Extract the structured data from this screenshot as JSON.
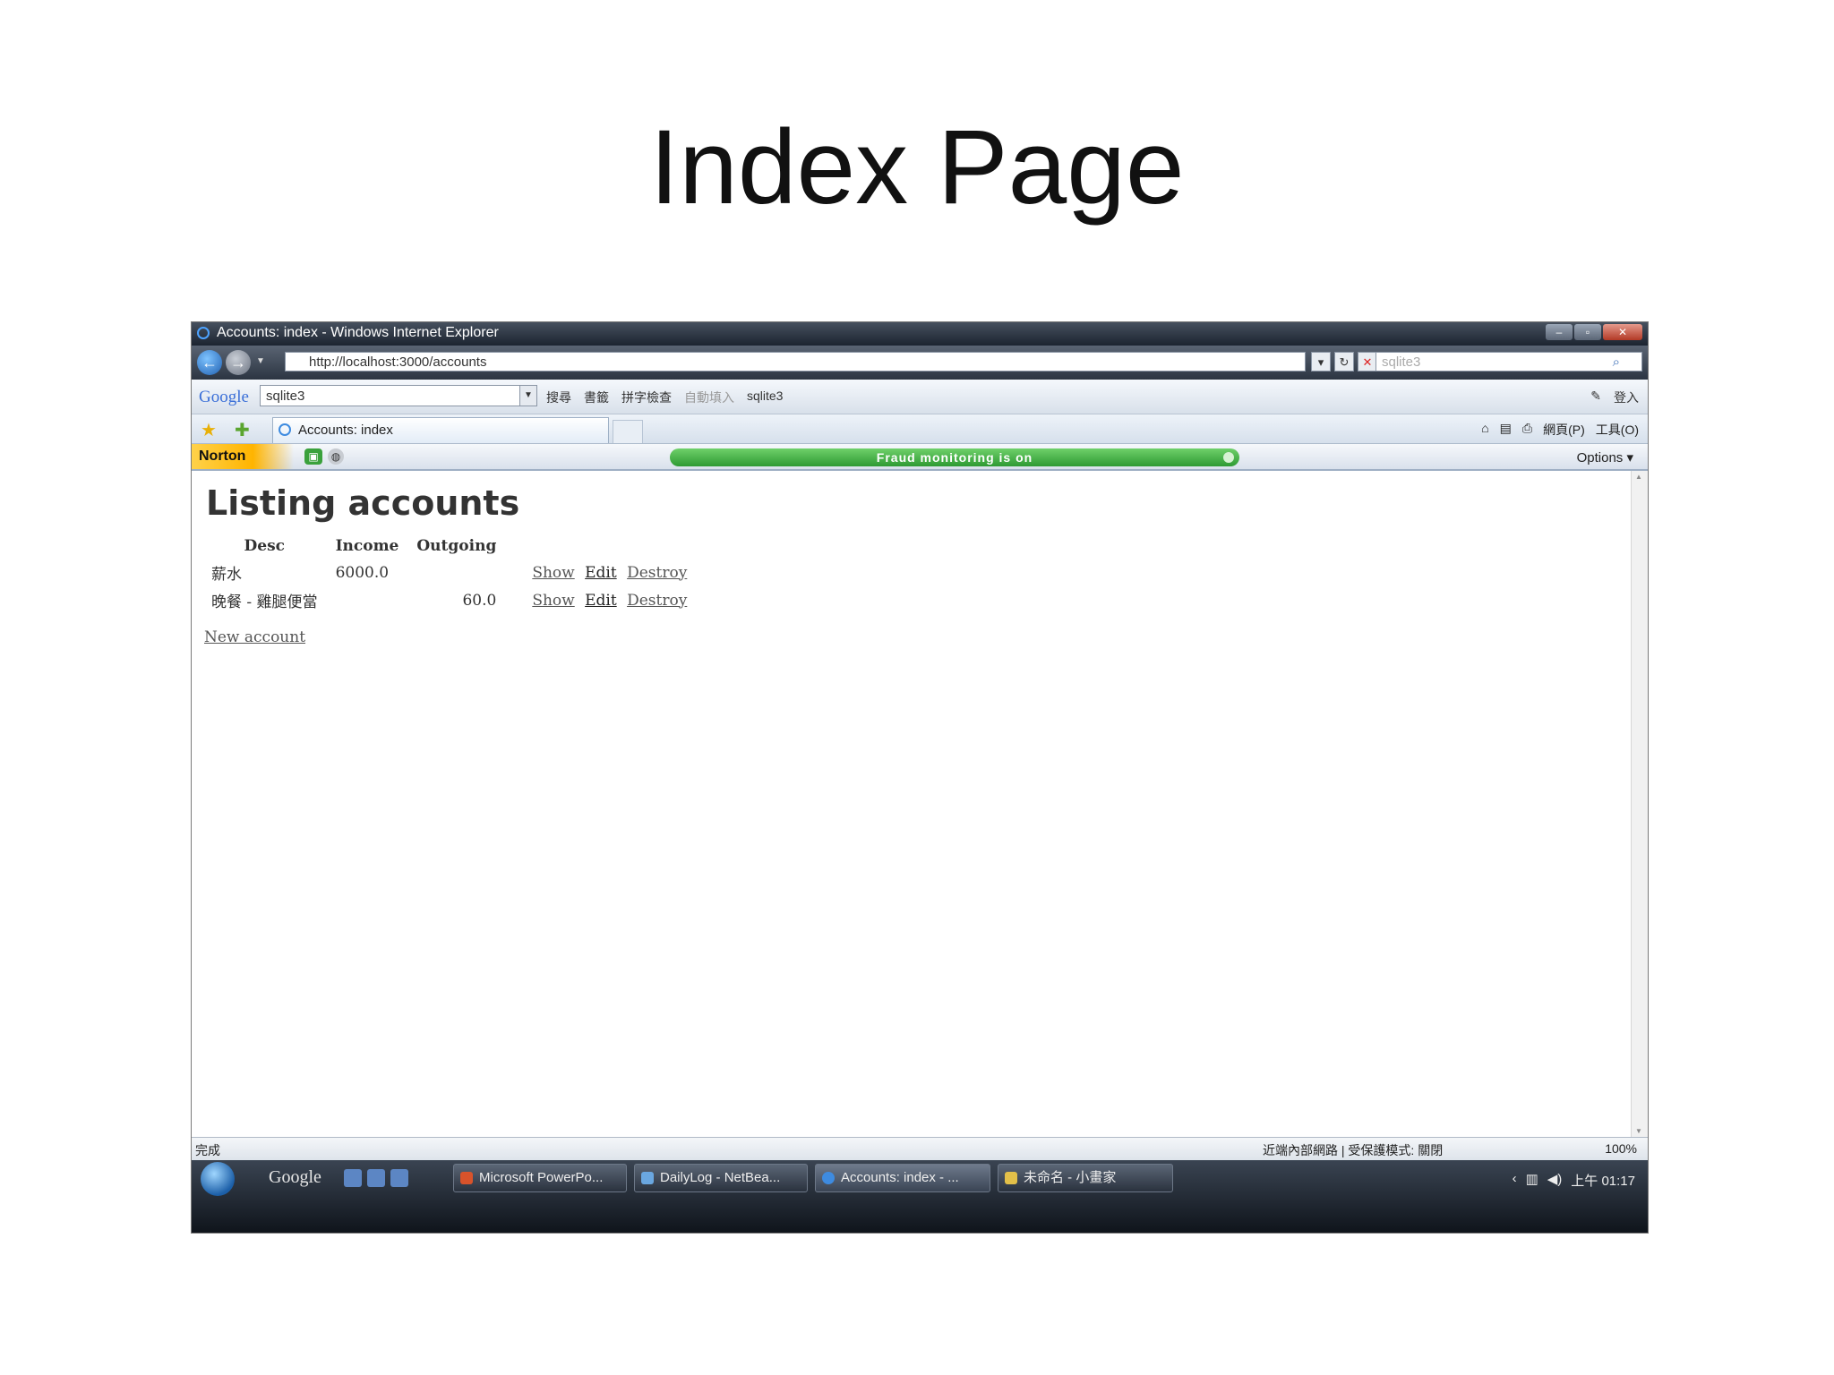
{
  "slide": {
    "title": "Index Page"
  },
  "browser": {
    "window_title": "Accounts: index - Windows Internet Explorer",
    "address": "http://localhost:3000/accounts",
    "search_placeholder": "sqlite3",
    "google_search_value": "sqlite3",
    "google_logo": "Google",
    "google_items": [
      "搜尋",
      "書籤",
      "拼字檢查",
      "自動填入",
      "sqlite3"
    ],
    "google_right": [
      "登入"
    ],
    "tab_title": "Accounts: index",
    "tab_tools": [
      "網頁(P)",
      "工具(O)"
    ],
    "norton_logo": "Norton",
    "fraud_status": "Fraud monitoring is on",
    "options_label": "Options",
    "status_left": "完成",
    "status_zone": "近端內部網路 | 受保護模式: 關閉",
    "zoom": "100%"
  },
  "page": {
    "heading": "Listing accounts",
    "columns": [
      "Desc",
      "Income",
      "Outgoing"
    ],
    "rows": [
      {
        "desc": "薪水",
        "income": "6000.0",
        "outgoing": "",
        "show": "Show",
        "edit": "Edit",
        "destroy": "Destroy"
      },
      {
        "desc": "晚餐 - 雞腿便當",
        "income": "",
        "outgoing": "60.0",
        "show": "Show",
        "edit": "Edit",
        "destroy": "Destroy"
      }
    ],
    "new_link": "New account"
  },
  "taskbar": {
    "google": "Google",
    "tasks": [
      "Microsoft PowerPo...",
      "DailyLog - NetBea...",
      "Accounts: index - ...",
      "未命名 - 小畫家"
    ],
    "clock": "上午 01:17"
  },
  "colors": {
    "fraud_green": "#2e9a33",
    "norton_yellow": "#ffb400",
    "titlebar": "#1c2430"
  }
}
